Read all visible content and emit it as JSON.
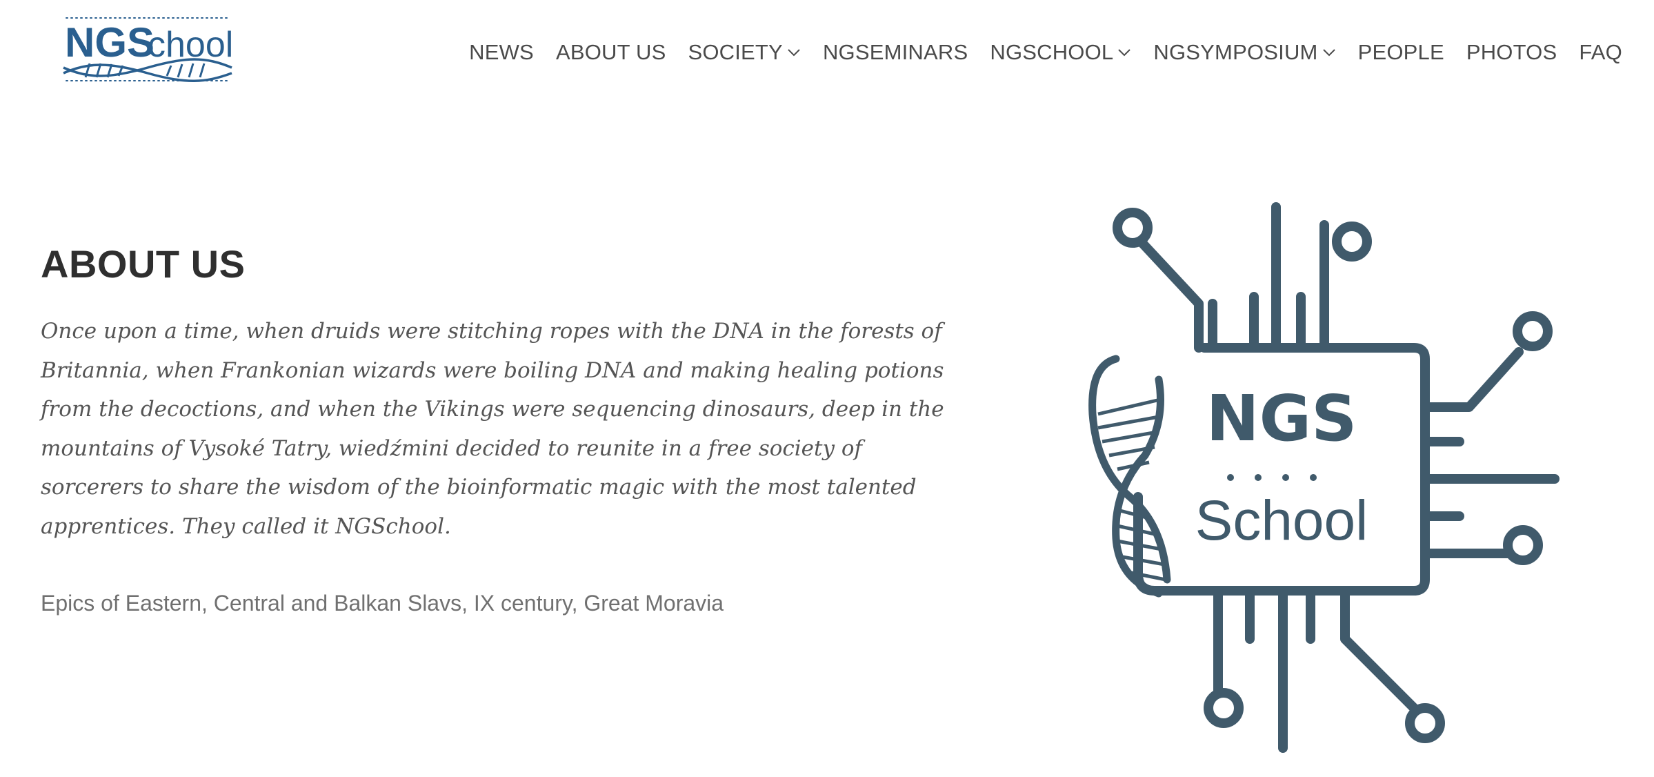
{
  "header": {
    "logo": {
      "text_bold": "NGS",
      "text_light": "chool"
    },
    "nav": [
      {
        "label": "NEWS",
        "has_dropdown": false
      },
      {
        "label": "ABOUT US",
        "has_dropdown": false
      },
      {
        "label": "SOCIETY",
        "has_dropdown": true
      },
      {
        "label": "NGSEMINARS",
        "has_dropdown": false
      },
      {
        "label": "NGSCHOOL",
        "has_dropdown": true
      },
      {
        "label": "NGSYMPOSIUM",
        "has_dropdown": true
      },
      {
        "label": "PEOPLE",
        "has_dropdown": false
      },
      {
        "label": "PHOTOS",
        "has_dropdown": false
      },
      {
        "label": "FAQ",
        "has_dropdown": false
      }
    ]
  },
  "main": {
    "title": "ABOUT US",
    "story": "Once upon a time, when druids were stitching ropes with the DNA in the forests of Britannia, when Frankonian wizards were boiling DNA and making healing potions from the decoctions, and when the Vikings were sequencing dinosaurs, deep in the mountains of Vysoké Tatry, wiedźmini decided to reunite in a free society of sorcerers to share the wisdom of the bioinformatic magic with the most talented apprentices. They called it NGSchool.",
    "source": "Epics of Eastern, Central and Balkan Slavs, IX century, Great Moravia"
  },
  "illustration": {
    "text_top": "NGS",
    "text_bottom": "School"
  },
  "colors": {
    "brand_dark": "#405a6b",
    "logo_blue": "#2a5f8f",
    "nav_text": "#4a4a4a",
    "title_text": "#2f2f2f",
    "story_text": "#555555",
    "source_text": "#707070"
  }
}
